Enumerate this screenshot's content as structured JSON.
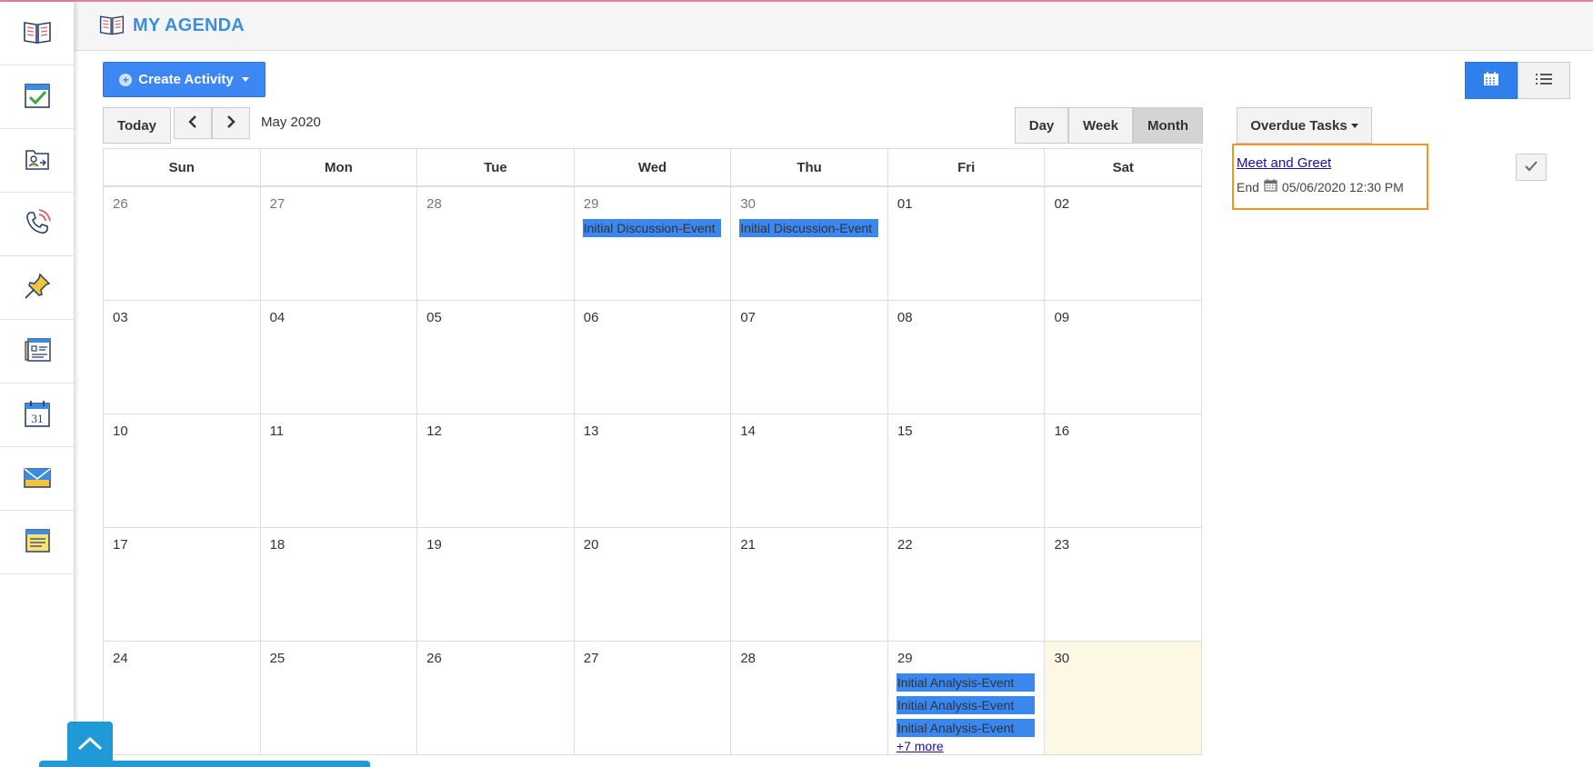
{
  "header": {
    "title": "MY AGENDA"
  },
  "sidebar": {
    "items": [
      {
        "icon": "book-icon"
      },
      {
        "icon": "task-check-icon"
      },
      {
        "icon": "contact-card-icon"
      },
      {
        "icon": "phone-call-icon"
      },
      {
        "icon": "pushpin-icon"
      },
      {
        "icon": "list-document-icon"
      },
      {
        "icon": "calendar-31-icon"
      },
      {
        "icon": "envelope-icon"
      },
      {
        "icon": "notepad-icon"
      }
    ]
  },
  "toolbar": {
    "create_label": "Create Activity",
    "today_label": "Today",
    "month_label": "May 2020",
    "day_label": "Day",
    "week_label": "Week",
    "month_view_label": "Month"
  },
  "calendar": {
    "weekdays": [
      "Sun",
      "Mon",
      "Tue",
      "Wed",
      "Thu",
      "Fri",
      "Sat"
    ],
    "weeks": [
      {
        "days": [
          {
            "num": "26",
            "events": []
          },
          {
            "num": "27",
            "events": []
          },
          {
            "num": "28",
            "events": []
          },
          {
            "num": "29",
            "events": [
              "Initial Discussion-Event"
            ]
          },
          {
            "num": "30",
            "events": [
              "Initial Discussion-Event"
            ]
          },
          {
            "num": "01",
            "events": []
          },
          {
            "num": "02",
            "events": []
          }
        ]
      },
      {
        "days": [
          {
            "num": "03",
            "events": []
          },
          {
            "num": "04",
            "events": []
          },
          {
            "num": "05",
            "events": []
          },
          {
            "num": "06",
            "events": []
          },
          {
            "num": "07",
            "events": []
          },
          {
            "num": "08",
            "events": []
          },
          {
            "num": "09",
            "events": []
          }
        ]
      },
      {
        "days": [
          {
            "num": "10",
            "events": []
          },
          {
            "num": "11",
            "events": []
          },
          {
            "num": "12",
            "events": []
          },
          {
            "num": "13",
            "events": []
          },
          {
            "num": "14",
            "events": []
          },
          {
            "num": "15",
            "events": []
          },
          {
            "num": "16",
            "events": []
          }
        ]
      },
      {
        "days": [
          {
            "num": "17",
            "events": []
          },
          {
            "num": "18",
            "events": []
          },
          {
            "num": "19",
            "events": []
          },
          {
            "num": "20",
            "events": []
          },
          {
            "num": "21",
            "events": []
          },
          {
            "num": "22",
            "events": []
          },
          {
            "num": "23",
            "events": []
          }
        ]
      },
      {
        "days": [
          {
            "num": "24",
            "events": []
          },
          {
            "num": "25",
            "events": []
          },
          {
            "num": "26",
            "events": []
          },
          {
            "num": "27",
            "events": []
          },
          {
            "num": "28",
            "events": []
          },
          {
            "num": "29",
            "events": [
              "Initial Analysis-Event",
              "Initial Analysis-Event",
              "Initial Analysis-Event"
            ],
            "more": "+7 more"
          },
          {
            "num": "30",
            "events": [],
            "today": true
          }
        ]
      }
    ]
  },
  "overdue": {
    "button_label": "Overdue Tasks",
    "task_title": "Meet and Greet",
    "end_label": "End",
    "end_datetime": "05/06/2020 12:30 PM"
  },
  "colors": {
    "accent": "#3a8fde",
    "event": "#3a87f0",
    "today": "#fcf8e3",
    "task_border": "#f7931e"
  }
}
